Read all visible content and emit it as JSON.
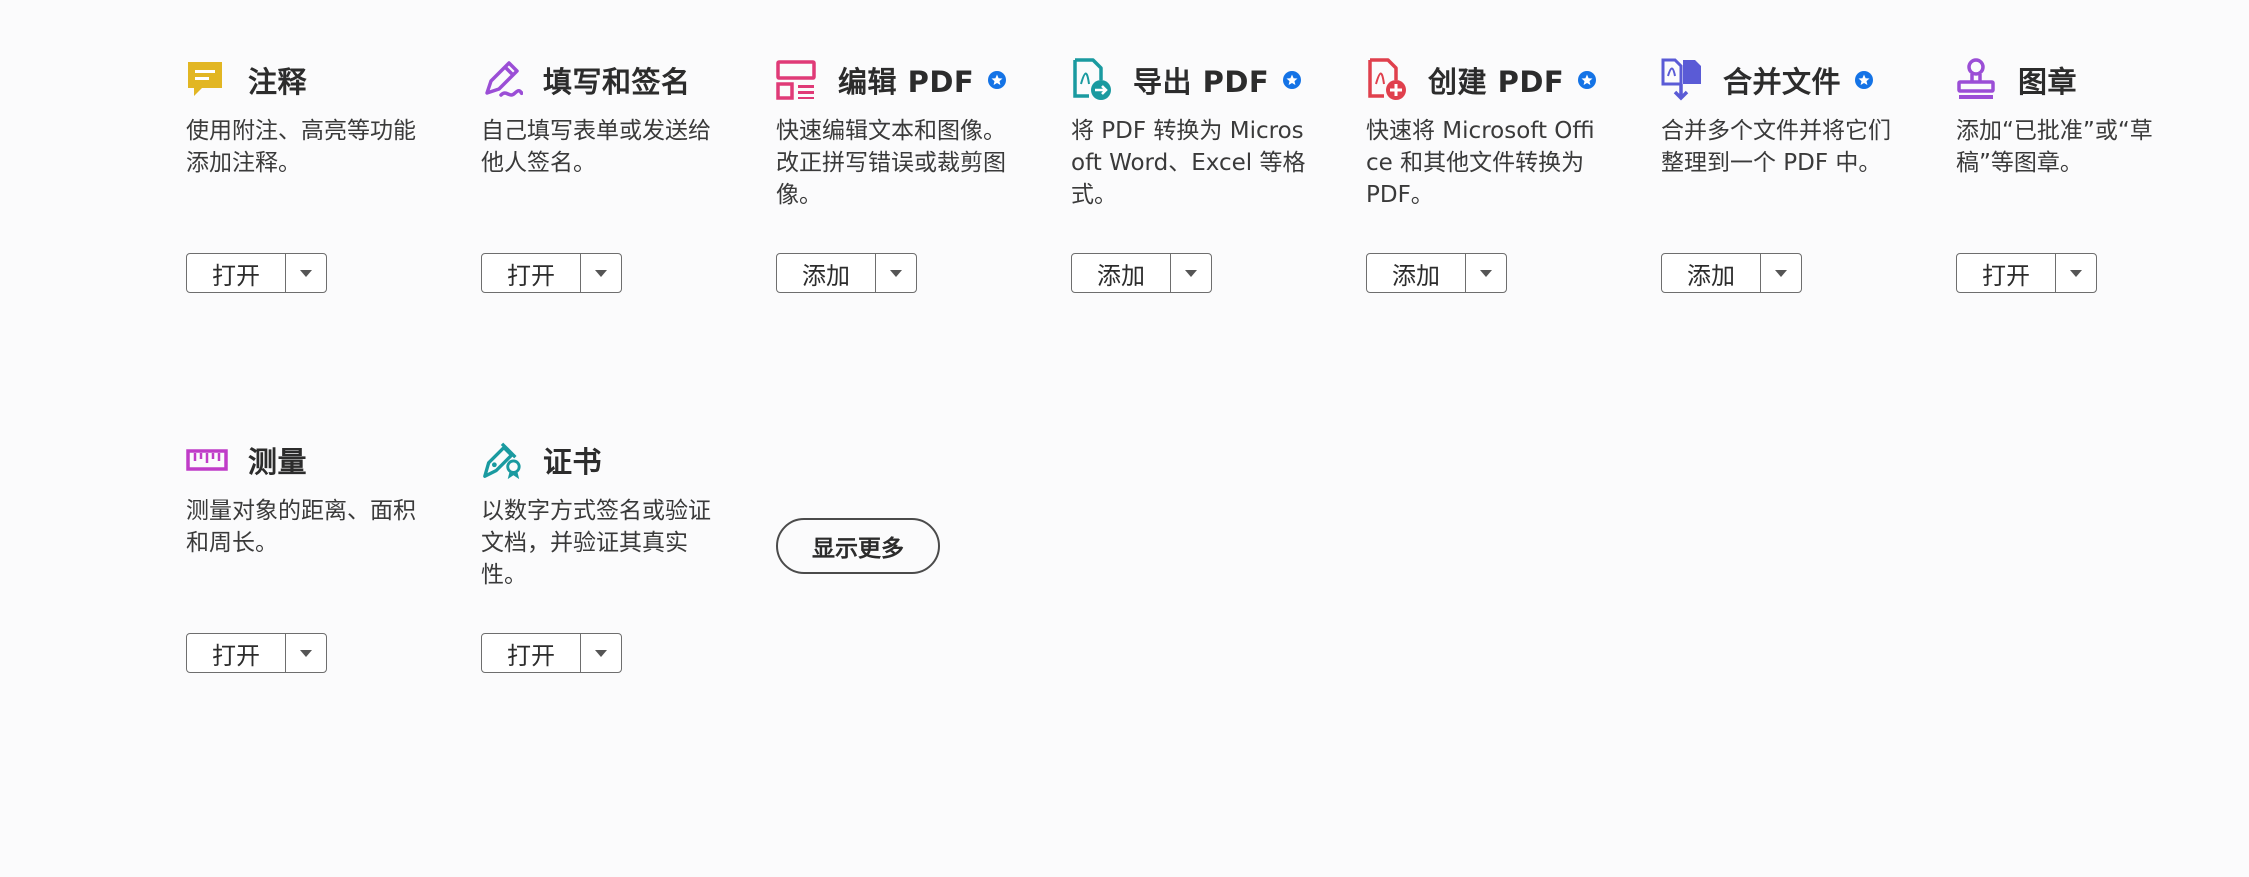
{
  "tools": [
    {
      "id": "comment",
      "title": "注释",
      "desc": "使用附注、高亮等功能添加注释。",
      "button": "打开",
      "premium": false,
      "icon": "comment-icon",
      "color": "#e2b623"
    },
    {
      "id": "fill-sign",
      "title": "填写和签名",
      "desc": "自己填写表单或发送给他人签名。",
      "button": "打开",
      "premium": false,
      "icon": "fill-sign-icon",
      "color": "#9b4ed6"
    },
    {
      "id": "edit-pdf",
      "title": "编辑 PDF",
      "desc": "快速编辑文本和图像。改正拼写错误或裁剪图像。",
      "button": "添加",
      "premium": true,
      "icon": "edit-pdf-icon",
      "color": "#e03a77"
    },
    {
      "id": "export-pdf",
      "title": "导出 PDF",
      "desc": "将 PDF 转换为 Microsoft Word、Excel 等格式。",
      "button": "添加",
      "premium": true,
      "icon": "export-pdf-icon",
      "color": "#1a9aa0"
    },
    {
      "id": "create-pdf",
      "title": "创建 PDF",
      "desc": "快速将 Microsoft Office 和其他文件转换为 PDF。",
      "button": "添加",
      "premium": true,
      "icon": "create-pdf-icon",
      "color": "#e0404d"
    },
    {
      "id": "combine",
      "title": "合并文件",
      "desc": "合并多个文件并将它们整理到一个 PDF 中。",
      "button": "添加",
      "premium": true,
      "icon": "combine-files-icon",
      "color": "#5a5bd6"
    },
    {
      "id": "stamp",
      "title": "图章",
      "desc": "添加“已批准”或“草稿”等图章。",
      "button": "打开",
      "premium": false,
      "icon": "stamp-icon",
      "color": "#9b4ed6"
    },
    {
      "id": "measure",
      "title": "测量",
      "desc": "测量对象的距离、面积和周长。",
      "button": "打开",
      "premium": false,
      "icon": "ruler-icon",
      "color": "#c03cc8"
    },
    {
      "id": "certificates",
      "title": "证书",
      "desc": "以数字方式签名或验证文档，并验证其真实性。",
      "button": "打开",
      "premium": false,
      "icon": "certificate-pen-icon",
      "color": "#1a9aa0"
    }
  ],
  "show_more": "显示更多",
  "premium_badge_color": "#1473e6"
}
